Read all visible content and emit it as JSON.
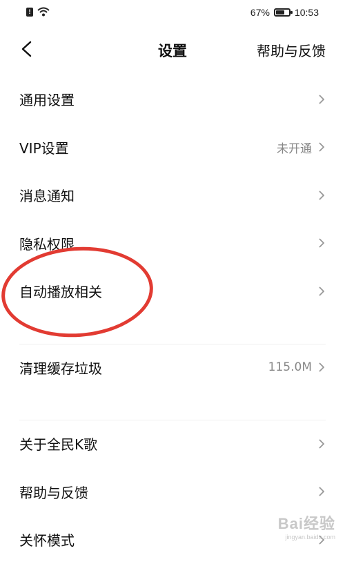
{
  "status_bar": {
    "battery_percent_label": "67%",
    "battery_level": 0.67,
    "time": "10:53",
    "icons": [
      "sim-alert-icon",
      "wifi-icon",
      "battery-icon"
    ]
  },
  "navbar": {
    "title": "设置",
    "help_label": "帮助与反馈",
    "back_icon": "chevron-left-icon"
  },
  "groups": [
    {
      "items": [
        {
          "label": "通用设置",
          "value": ""
        },
        {
          "label": "VIP设置",
          "value": "未开通"
        },
        {
          "label": "消息通知",
          "value": ""
        },
        {
          "label": "隐私权限",
          "value": ""
        },
        {
          "label": "自动播放相关",
          "value": ""
        }
      ]
    },
    {
      "items": [
        {
          "label": "清理缓存垃圾",
          "value": "115.0M"
        }
      ]
    },
    {
      "items": [
        {
          "label": "关于全民K歌",
          "value": ""
        },
        {
          "label": "帮助与反馈",
          "value": ""
        },
        {
          "label": "关怀模式",
          "value": ""
        }
      ]
    }
  ],
  "annotation_color": "#e23b32",
  "watermark": {
    "main": "Bai经验",
    "sub": "jingyan.baidu.com"
  }
}
